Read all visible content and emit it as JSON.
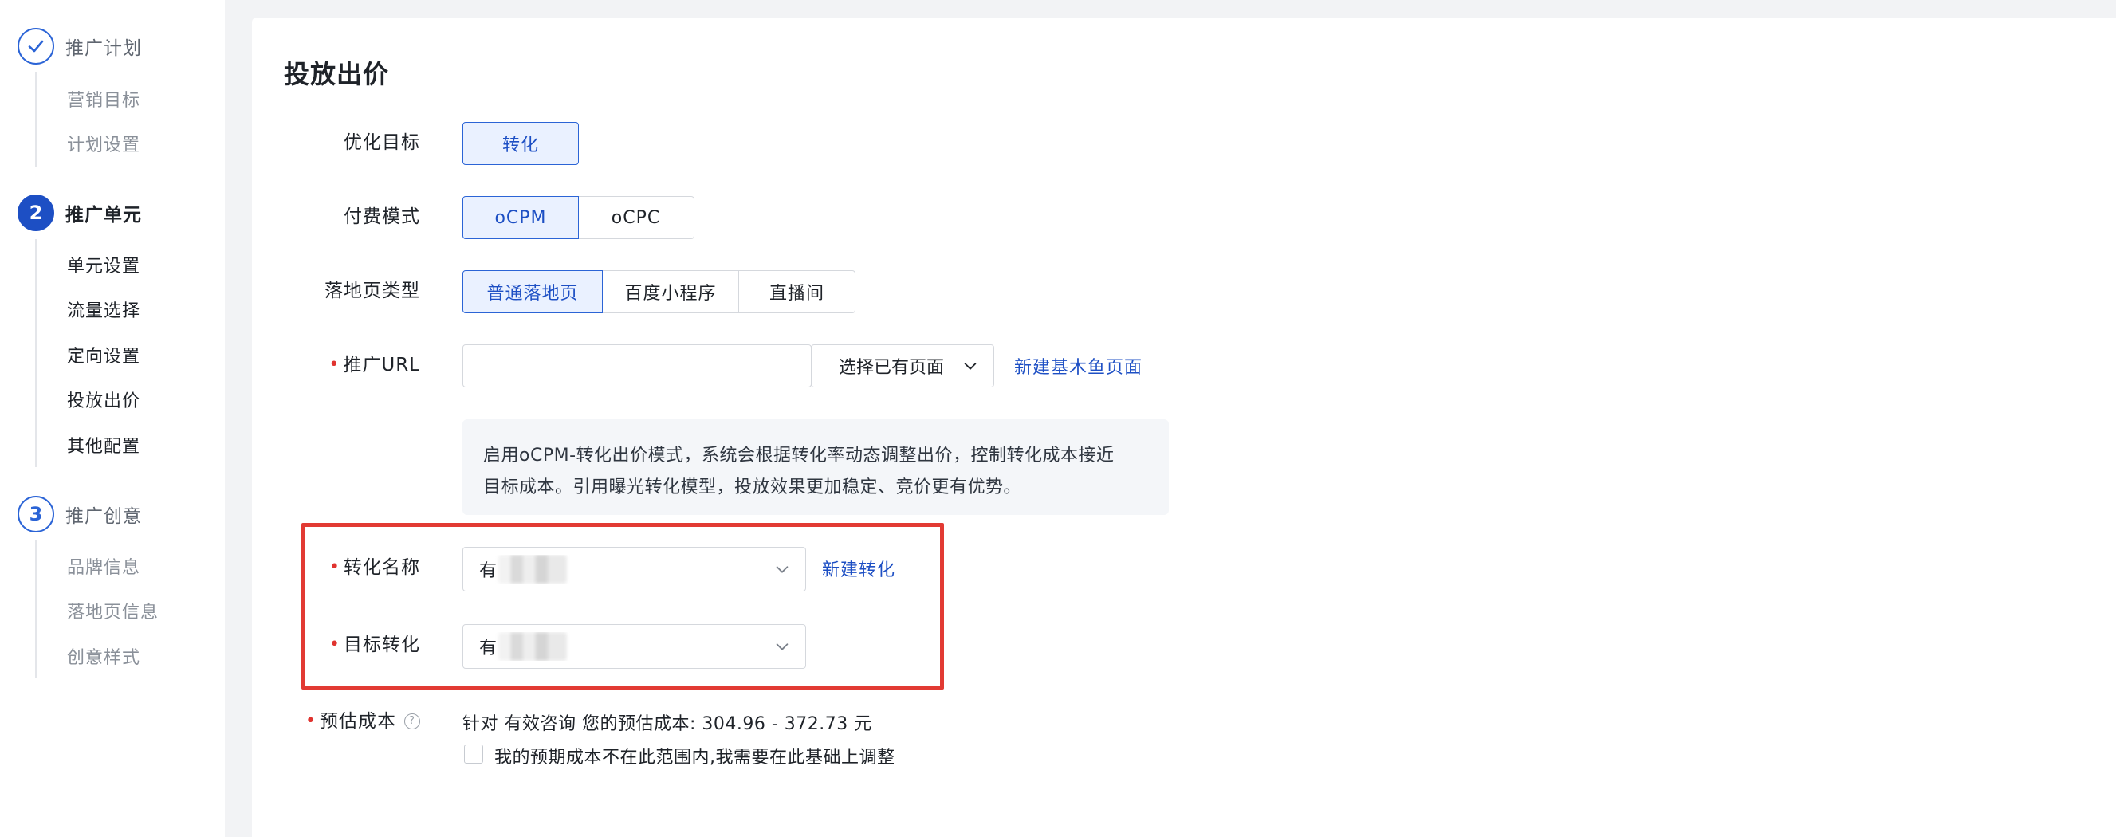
{
  "sidebar": {
    "steps": [
      {
        "number": "",
        "title": "推广计划",
        "state": "done",
        "items": [
          "营销目标",
          "计划设置"
        ]
      },
      {
        "number": "2",
        "title": "推广单元",
        "state": "active",
        "items": [
          "单元设置",
          "流量选择",
          "定向设置",
          "投放出价",
          "其他配置"
        ]
      },
      {
        "number": "3",
        "title": "推广创意",
        "state": "pending",
        "items": [
          "品牌信息",
          "落地页信息",
          "创意样式"
        ]
      }
    ]
  },
  "section": {
    "title": "投放出价"
  },
  "form": {
    "optimize_goal": {
      "label": "优化目标",
      "options": [
        "转化"
      ],
      "selected": "转化"
    },
    "pay_mode": {
      "label": "付费模式",
      "options": [
        "oCPM",
        "oCPC"
      ],
      "selected": "oCPM"
    },
    "landing_type": {
      "label": "落地页类型",
      "options": [
        "普通落地页",
        "百度小程序",
        "直播间"
      ],
      "selected": "普通落地页"
    },
    "promo_url": {
      "label": "推广URL",
      "required": true,
      "value": "",
      "placeholder": "",
      "select_label": "选择已有页面",
      "new_page_link": "新建基木鱼页面"
    },
    "tip": {
      "line1": "启用oCPM-转化出价模式，系统会根据转化率动态调整出价，控制转化成本接近",
      "line2": "目标成本。引用曝光转化模型，投放效果更加稳定、竞价更有优势。"
    },
    "conversion_name": {
      "label": "转化名称",
      "required": true,
      "value": "有",
      "new_link": "新建转化"
    },
    "target_conversion": {
      "label": "目标转化",
      "required": true,
      "value": "有"
    },
    "estimated_cost": {
      "label": "预估成本",
      "required": true,
      "text": "针对 有效咨询 您的预估成本: 304.96 - 372.73 元",
      "checkbox_label": "我的预期成本不在此范围内,我需要在此基础上调整",
      "checked": false
    }
  },
  "colors": {
    "accent": "#1d4fc4",
    "highlight": "#e23a33",
    "required": "#e0332f"
  }
}
